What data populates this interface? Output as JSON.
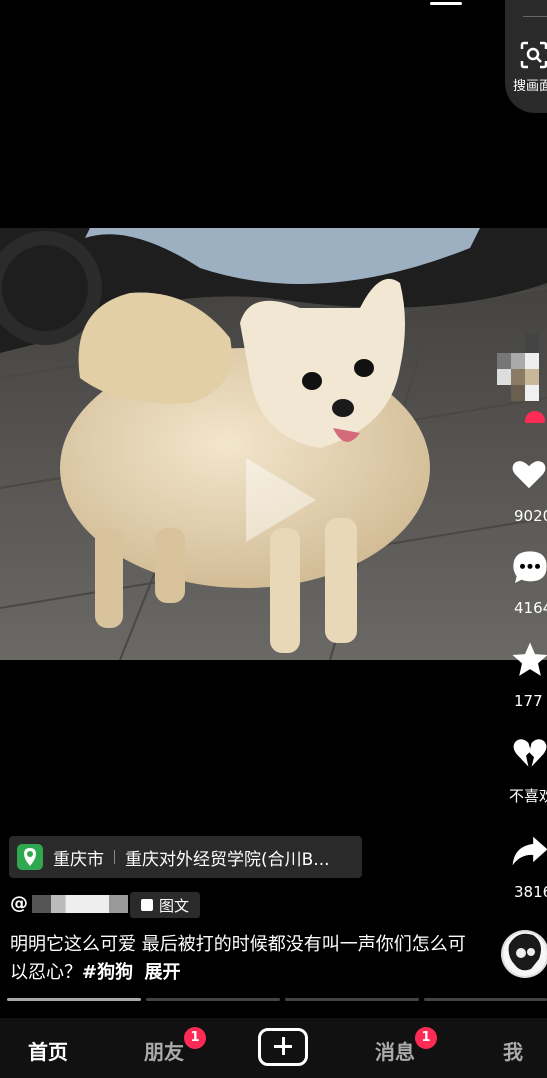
{
  "search": {
    "label": "搜画面"
  },
  "video": {
    "paused": true
  },
  "actions": {
    "like_count": "9020",
    "comment_count": "4164",
    "favorite_count": "177",
    "dislike_label": "不喜欢",
    "share_count": "3816"
  },
  "location": {
    "city": "重庆市",
    "place": "重庆对外经贸学院(合川B..."
  },
  "author": {
    "prefix": "@",
    "tag_label": "图文"
  },
  "description": {
    "text": "明明它这么可爱 最后被打的时候都没有叫一声你们怎么可以忍心？",
    "hashtag": "#狗狗",
    "expand": "展开"
  },
  "nav": {
    "home": "首页",
    "friends": "朋友",
    "friends_badge": "1",
    "messages": "消息",
    "messages_badge": "1",
    "me": "我"
  },
  "colors": {
    "accent": "#fe2c55",
    "location_pin": "#2fa84f"
  }
}
